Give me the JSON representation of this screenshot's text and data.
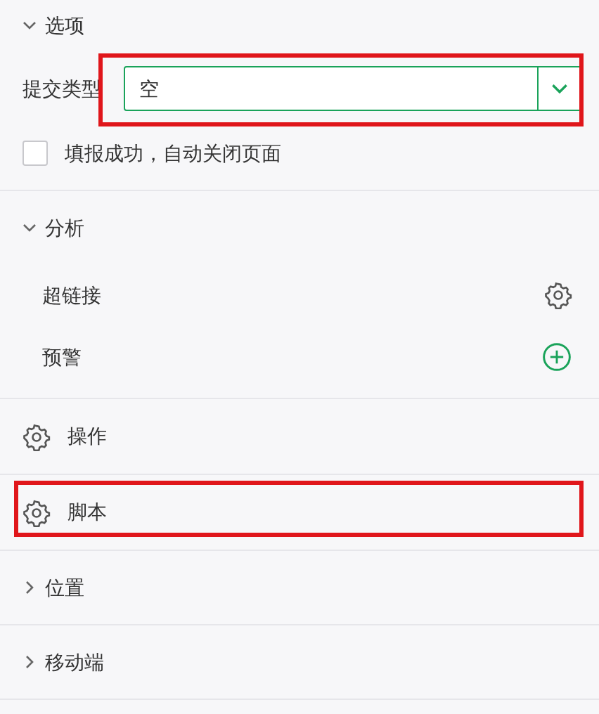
{
  "sections": [
    {
      "kind": "group",
      "title": "选项",
      "expanded": true,
      "items": [
        {
          "kind": "select",
          "label": "提交类型",
          "value": "空",
          "highlighted": true
        },
        {
          "kind": "checkbox",
          "label": "填报成功，自动关闭页面",
          "checked": false
        }
      ]
    },
    {
      "kind": "group",
      "title": "分析",
      "expanded": true,
      "items": [
        {
          "kind": "gear",
          "label": "超链接"
        },
        {
          "kind": "add",
          "label": "预警"
        }
      ]
    },
    {
      "kind": "setting",
      "title": "操作",
      "highlighted": false
    },
    {
      "kind": "setting",
      "title": "脚本",
      "highlighted": true
    },
    {
      "kind": "group",
      "title": "位置",
      "expanded": false
    },
    {
      "kind": "group",
      "title": "移动端",
      "expanded": false
    }
  ]
}
